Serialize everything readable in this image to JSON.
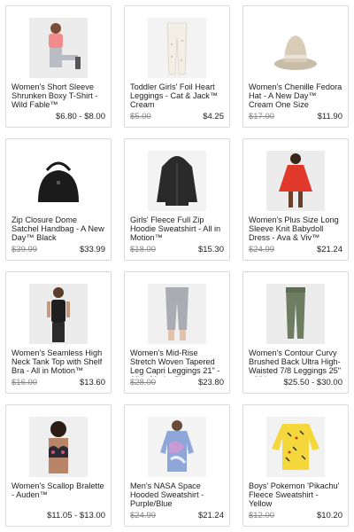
{
  "products": [
    {
      "title": "Women's Short Sleeve Shrunken Boxy T-Shirt - Wild Fable™",
      "original_price": "",
      "price": "$6.80 - $8.00",
      "image": "model-pink-tshirt"
    },
    {
      "title": "Toddler Girls' Foil Heart Leggings - Cat & Jack™ Cream",
      "original_price": "$5.00",
      "price": "$4.25",
      "image": "cream-leggings"
    },
    {
      "title": "Women's Chenille Fedora Hat - A New Day™ Cream One Size",
      "original_price": "$17.00",
      "price": "$11.90",
      "image": "fedora-hat"
    },
    {
      "title": "Zip Closure Dome Satchel Handbag - A New Day™ Black",
      "original_price": "$39.99",
      "price": "$33.99",
      "image": "black-handbag"
    },
    {
      "title": "Girls' Fleece Full Zip Hoodie Sweatshirt - All in Motion™",
      "original_price": "$18.00",
      "price": "$15.30",
      "image": "black-hoodie"
    },
    {
      "title": "Women's Plus Size Long Sleeve Knit Babydoll Dress - Ava & Viv™",
      "original_price": "$24.99",
      "price": "$21.24",
      "image": "red-dress"
    },
    {
      "title": "Women's Seamless High Neck Tank Top with Shelf Bra - All in Motion™",
      "original_price": "$16.00",
      "price": "$13.60",
      "image": "black-tank-top"
    },
    {
      "title": "Women's Mid-Rise Stretch Woven Tapered Leg Capri Leggings 21\" - All in Motion™",
      "original_price": "$28.00",
      "price": "$23.80",
      "image": "grey-capri"
    },
    {
      "title": "Women's Contour Curvy Brushed Back Ultra High-Waisted 7/8 Leggings 25\" - All in ...",
      "original_price": "",
      "price": "$25.50 - $30.00",
      "image": "green-leggings"
    },
    {
      "title": "Women's Scallop Bralette - Auden™",
      "original_price": "",
      "price": "$11.05 - $13.00",
      "image": "floral-bralette"
    },
    {
      "title": "Men's NASA Space Hooded Sweatshirt - Purple/Blue",
      "original_price": "$24.99",
      "price": "$21.24",
      "image": "tie-dye-hoodie"
    },
    {
      "title": "Boys' Pokemon 'Pikachu' Fleece Sweatshirt - Yellow",
      "original_price": "$12.00",
      "price": "$10.20",
      "image": "yellow-sweatshirt"
    }
  ]
}
